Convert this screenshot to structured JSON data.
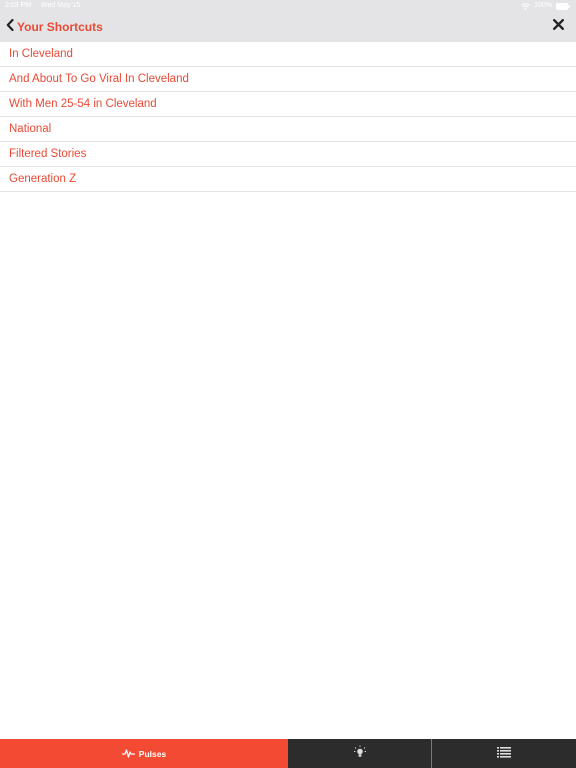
{
  "status_bar": {
    "time": "2:03 PM",
    "date": "Wed May 15",
    "battery": "100%"
  },
  "header": {
    "title": "Your Shortcuts",
    "back_icon": "chevron-left-icon",
    "close_icon": "close-icon"
  },
  "shortcuts": [
    "In Cleveland",
    "And About To Go Viral In Cleveland",
    "With Men 25-54 in Cleveland",
    "National",
    "Filtered Stories",
    "Generation Z"
  ],
  "tab_bar": {
    "pulses_label": "Pulses",
    "pulses_icon": "pulse-icon",
    "insights_icon": "lightbulb-icon",
    "list_icon": "list-icon",
    "active_tab": "Pulses"
  },
  "colors": {
    "accent": "#e84a36",
    "header_bg": "#e4e4e6",
    "tab_active_bg": "#f24a33",
    "tab_inactive_bg": "#2c2c2c"
  }
}
